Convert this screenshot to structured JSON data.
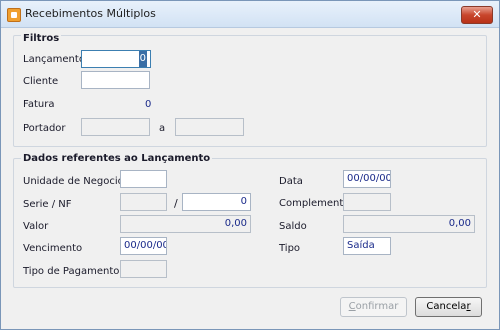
{
  "window": {
    "title": "Recebimentos Múltiplos",
    "close_glyph": "✕",
    "app_icon": "receipt-app-icon"
  },
  "filtros": {
    "title": "Filtros",
    "lancamento_label": "Lançamento",
    "lancamento_value": "0",
    "cliente_label": "Cliente",
    "cliente_value": "",
    "fatura_label": "Fatura",
    "fatura_value": "0",
    "portador_label": "Portador",
    "portador_separator": "a",
    "portador_from": "",
    "portador_to": ""
  },
  "dados": {
    "title": "Dados referentes ao Lançamento",
    "unidade_label": "Unidade de Negocio",
    "unidade_value": "",
    "serie_label": "Serie / NF",
    "serie_value": "",
    "serie_separator": "/",
    "nf_value": "0",
    "valor_label": "Valor",
    "valor_value": "0,00",
    "vencimento_label": "Vencimento",
    "vencimento_value": "00/00/00",
    "tipo_pagamento_label": "Tipo de Pagamento",
    "tipo_pagamento_value": "",
    "data_label": "Data",
    "data_value": "00/00/00",
    "complemento_label": "Complemento",
    "complemento_value": "",
    "saldo_label": "Saldo",
    "saldo_value": "0,00",
    "tipo_label": "Tipo",
    "tipo_value": "Saída"
  },
  "buttons": {
    "confirm_first": "C",
    "confirm_rest": "onfirmar",
    "cancel_first": "Cancela",
    "cancel_last": "r"
  }
}
